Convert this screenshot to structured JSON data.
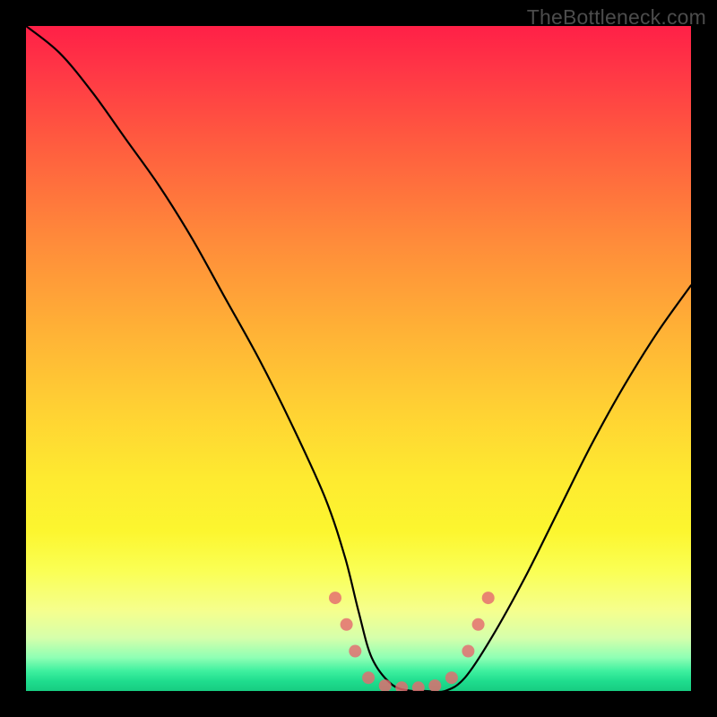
{
  "watermark": "TheBottleneck.com",
  "chart_data": {
    "type": "line",
    "title": "",
    "xlabel": "",
    "ylabel": "",
    "xlim": [
      0,
      100
    ],
    "ylim": [
      0,
      100
    ],
    "legend": false,
    "grid": false,
    "background_gradient": {
      "direction": "vertical",
      "stops": [
        {
          "pos": 0,
          "color": "#ff2047"
        },
        {
          "pos": 50,
          "color": "#ffc334"
        },
        {
          "pos": 80,
          "color": "#fcfb40"
        },
        {
          "pos": 100,
          "color": "#17cc81"
        }
      ]
    },
    "series": [
      {
        "name": "curve",
        "x": [
          0,
          5,
          10,
          15,
          20,
          25,
          30,
          35,
          40,
          45,
          48,
          50,
          52,
          55,
          58,
          60,
          63,
          66,
          70,
          75,
          80,
          85,
          90,
          95,
          100
        ],
        "y": [
          100,
          96,
          90,
          83,
          76,
          68,
          59,
          50,
          40,
          29,
          20,
          12,
          5,
          1,
          0,
          0,
          0,
          2,
          8,
          17,
          27,
          37,
          46,
          54,
          61
        ]
      }
    ],
    "markers": [
      {
        "x": 46.5,
        "y": 14
      },
      {
        "x": 48.2,
        "y": 10
      },
      {
        "x": 49.5,
        "y": 6
      },
      {
        "x": 51.5,
        "y": 2
      },
      {
        "x": 54.0,
        "y": 0.8
      },
      {
        "x": 56.5,
        "y": 0.5
      },
      {
        "x": 59.0,
        "y": 0.5
      },
      {
        "x": 61.5,
        "y": 0.8
      },
      {
        "x": 64.0,
        "y": 2
      },
      {
        "x": 66.5,
        "y": 6
      },
      {
        "x": 68.0,
        "y": 10
      },
      {
        "x": 69.5,
        "y": 14
      }
    ]
  }
}
